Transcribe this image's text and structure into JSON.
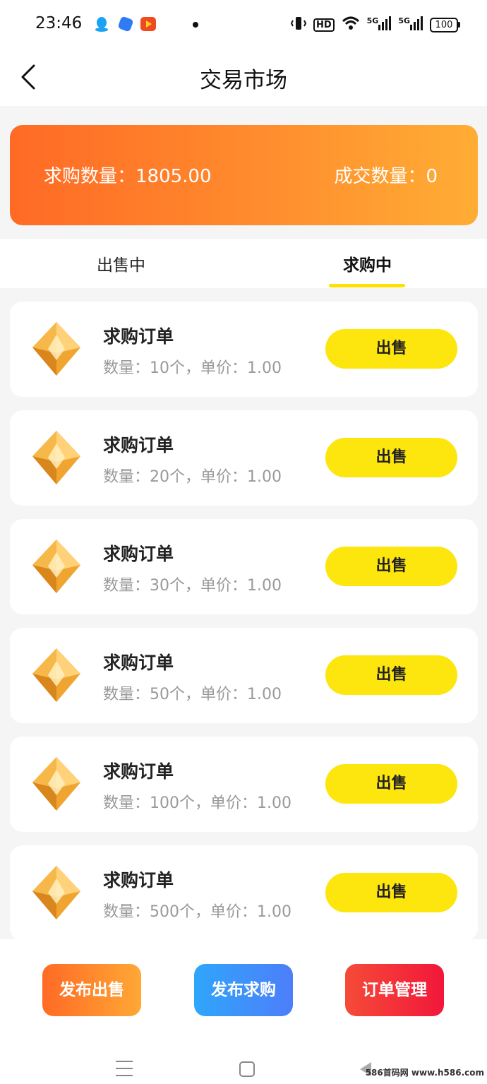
{
  "status_bar": {
    "time": "23:46",
    "icons": [
      "qq-icon",
      "app-icon",
      "video-app-icon",
      "vibrate-icon",
      "hd-icon",
      "wifi-icon",
      "signal-5g-icon",
      "signal-5g-icon"
    ],
    "hd_label": "HD",
    "signal_label": "5G",
    "battery": "100"
  },
  "header": {
    "title": "交易市场",
    "back_icon": "chevron-left-icon"
  },
  "summary": {
    "demand_label": "求购数量：1805.00",
    "deal_label": "成交数量：0",
    "colors": {
      "from": "#ff6a25",
      "to": "#ffad35"
    }
  },
  "tabs": [
    {
      "label": "出售中",
      "active": false
    },
    {
      "label": "求购中",
      "active": true
    }
  ],
  "orders": [
    {
      "title": "求购订单",
      "detail": "数量：10个，单价：1.00",
      "button": "出售"
    },
    {
      "title": "求购订单",
      "detail": "数量：20个，单价：1.00",
      "button": "出售"
    },
    {
      "title": "求购订单",
      "detail": "数量：30个，单价：1.00",
      "button": "出售"
    },
    {
      "title": "求购订单",
      "detail": "数量：50个，单价：1.00",
      "button": "出售"
    },
    {
      "title": "求购订单",
      "detail": "数量：100个，单价：1.00",
      "button": "出售"
    },
    {
      "title": "求购订单",
      "detail": "数量：500个，单价：1.00",
      "button": "出售"
    }
  ],
  "bottom_actions": {
    "publish_sell": "发布出售",
    "publish_buy": "发布求购",
    "order_manage": "订单管理"
  },
  "watermark": "586首码网 www.h586.com",
  "accent_color": "#fde50e"
}
